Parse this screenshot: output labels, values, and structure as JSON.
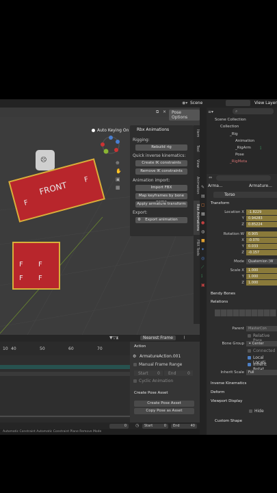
{
  "header": {
    "scene_label": "Scene",
    "view_layer_label": "View Layer"
  },
  "viewport": {
    "pose_options": "Pose Options",
    "auto_keying": "Auto Keying On",
    "character_front_text": "FRONT",
    "face_text": "F"
  },
  "rbx_panel": {
    "title": "Rbx Animations",
    "rigging_label": "Rigging:",
    "rebuild_rig": "Rebuild rig",
    "quick_ik_label": "Quick inverse kinematics:",
    "create_ik": "Create IK constraints",
    "remove_ik": "Remove IK constraints",
    "import_label": "Animation import:",
    "import_fbx": "Import FBX",
    "map_keyframes": "Map keyframes by bone name",
    "apply_transform": "Apply armature transform",
    "export_label": "Export:",
    "export_animation": "Export animation"
  },
  "side_tabs": [
    "Item",
    "Tool",
    "View",
    "Animation",
    "Rbx Animations",
    "FBX Tools"
  ],
  "timeline": {
    "snap_mode": "Nearest Frame",
    "ticks": [
      "10",
      "40",
      "50",
      "60",
      "70"
    ],
    "action_header": "Action",
    "action_name": "ArmatureAction.001",
    "manual_frame_range": "Manual Frame Range",
    "start_label": "Start",
    "start_value": "0",
    "end_label": "End",
    "end_value": "0",
    "cyclic": "Cyclic Animation",
    "create_pose_header": "Create Pose Asset",
    "create_pose_btn": "Create Pose Asset",
    "copy_pose_btn": "Copy Pose as Asset",
    "current_frame": "0",
    "bottom_start_label": "Start",
    "bottom_start": "0",
    "bottom_end_label": "End",
    "bottom_end": "40",
    "status_text": "Automatic Constraint   Automatic Constraint Plane   Remove Mode"
  },
  "outliner": {
    "scene_collection": "Scene Collection",
    "collection": "Collection",
    "items": [
      "_Rig",
      "Animation",
      "_RigArm",
      "Pose",
      "_RigMeta"
    ]
  },
  "properties": {
    "breadcrumb_a": "Arma...",
    "breadcrumb_b": "Armature...",
    "bone_name": "Torso",
    "transform_header": "Transform",
    "location_x_label": "Location X",
    "location_x": "-1.8229",
    "location_y_label": "Y",
    "location_y": "0.94283",
    "location_z_label": "Z",
    "location_z": "0.85224",
    "rotation_w_label": "Rotation W",
    "rotation_w": "0.905",
    "rotation_x_label": "X",
    "rotation_x": "-0.070",
    "rotation_y_label": "Y",
    "rotation_y": "0.033",
    "rotation_z_label": "Z",
    "rotation_z": "-0.157",
    "mode_label": "Mode",
    "mode_value": "Quaternion (W",
    "scale_x_label": "Scale X",
    "scale_x": "1.000",
    "scale_y_label": "Y",
    "scale_y": "1.000",
    "scale_z_label": "Z",
    "scale_z": "1.000",
    "bendy_bones": "Bendy Bones",
    "relations": "Relations",
    "parent_label": "Parent",
    "parent_value": "MasterCon",
    "relative_parent": "Relative Pare",
    "bone_group_label": "Bone Group",
    "bone_group_value": "Center",
    "connected": "Connected",
    "local_location": "Local Locati",
    "inherit_rotation": "Inherit Rotat",
    "inherit_scale_label": "Inherit Scale",
    "inherit_scale_value": "Full",
    "inverse_kinematics": "Inverse Kinematics",
    "deform": "Deform",
    "viewport_display": "Viewport Display",
    "hide": "Hide",
    "custom_shape": "Custom Shape"
  },
  "colors": {
    "accent_yellow": "#8a7a3a",
    "torso_red": "#b8262c",
    "limb_yellow": "#d7b13a",
    "panel_bg": "#303030"
  }
}
